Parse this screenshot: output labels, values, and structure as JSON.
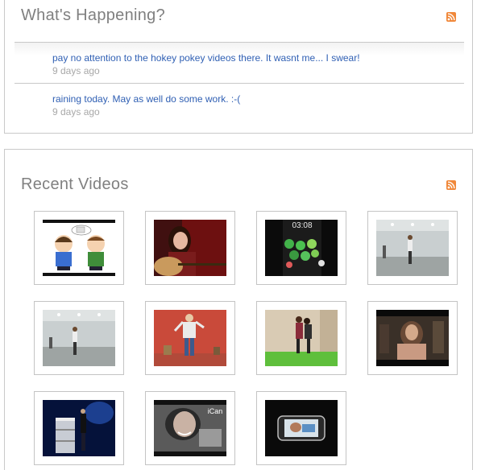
{
  "happening": {
    "title": "What's Happening?",
    "rss_icon": "rss-feed-icon",
    "statuses": [
      {
        "text": "pay no attention to the hokey pokey videos there. It wasnt me... I swear!",
        "time": "9 days ago"
      },
      {
        "text": "raining today. May as well do some work. :-(",
        "time": "9 days ago"
      }
    ]
  },
  "videos": {
    "title": "Recent Videos",
    "rss_icon": "rss-feed-icon",
    "thumbnails": [
      {
        "icon": "cartoon-characters-thumbnail"
      },
      {
        "icon": "guitar-player-thumbnail"
      },
      {
        "icon": "phone-clock-thumbnail",
        "overlay_text": "03:08"
      },
      {
        "icon": "dancer-in-room-thumbnail"
      },
      {
        "icon": "dancer-in-room-thumbnail"
      },
      {
        "icon": "dancer-red-wall-thumbnail"
      },
      {
        "icon": "couple-dancing-thumbnail"
      },
      {
        "icon": "music-video-thumbnail"
      },
      {
        "icon": "presenter-on-stage-thumbnail"
      },
      {
        "icon": "ican-ad-thumbnail",
        "overlay_text": "iCan"
      },
      {
        "icon": "phone-screen-thumbnail"
      }
    ]
  },
  "colors": {
    "link": "#2f5fb3",
    "muted_text": "#a8a8a8",
    "title_text": "#808080",
    "rss_orange": "#f0883a"
  }
}
